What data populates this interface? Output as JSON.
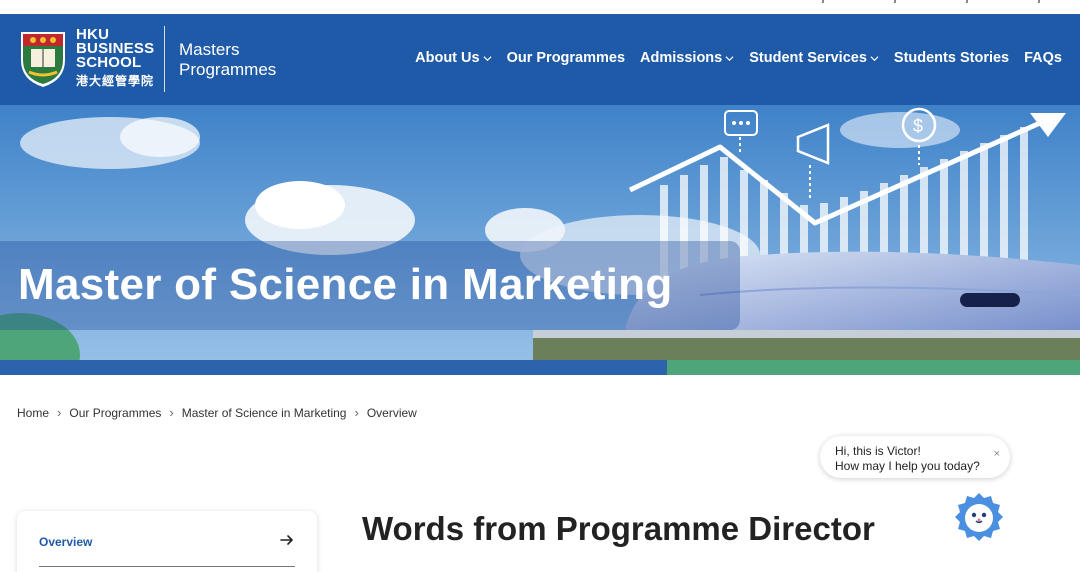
{
  "brand": {
    "line1": "HKU",
    "line2": "BUSINESS",
    "line3": "SCHOOL",
    "chinese": "港大經管學院",
    "section_line1": "Masters",
    "section_line2": "Programmes"
  },
  "nav": [
    {
      "label": "About Us",
      "has_dropdown": true
    },
    {
      "label": "Our Programmes",
      "has_dropdown": false
    },
    {
      "label": "Admissions",
      "has_dropdown": true
    },
    {
      "label": "Student Services",
      "has_dropdown": true
    },
    {
      "label": "Students Stories",
      "has_dropdown": false
    },
    {
      "label": "FAQs",
      "has_dropdown": false
    }
  ],
  "hero": {
    "title": "Master of Science in Marketing"
  },
  "breadcrumb": [
    "Home",
    "Our Programmes",
    "Master of Science in Marketing",
    "Overview"
  ],
  "sidebar": {
    "active_item": "Overview"
  },
  "main": {
    "heading": "Words from Programme Director"
  },
  "chat": {
    "line1": "Hi, this is Victor!",
    "line2": "How may I help you today?",
    "close_glyph": "×"
  },
  "colors": {
    "header": "#1f5aa9",
    "stripe_blue": "#2d63ad",
    "stripe_green": "#4ea57a",
    "accent_text": "#1f5aa9"
  }
}
